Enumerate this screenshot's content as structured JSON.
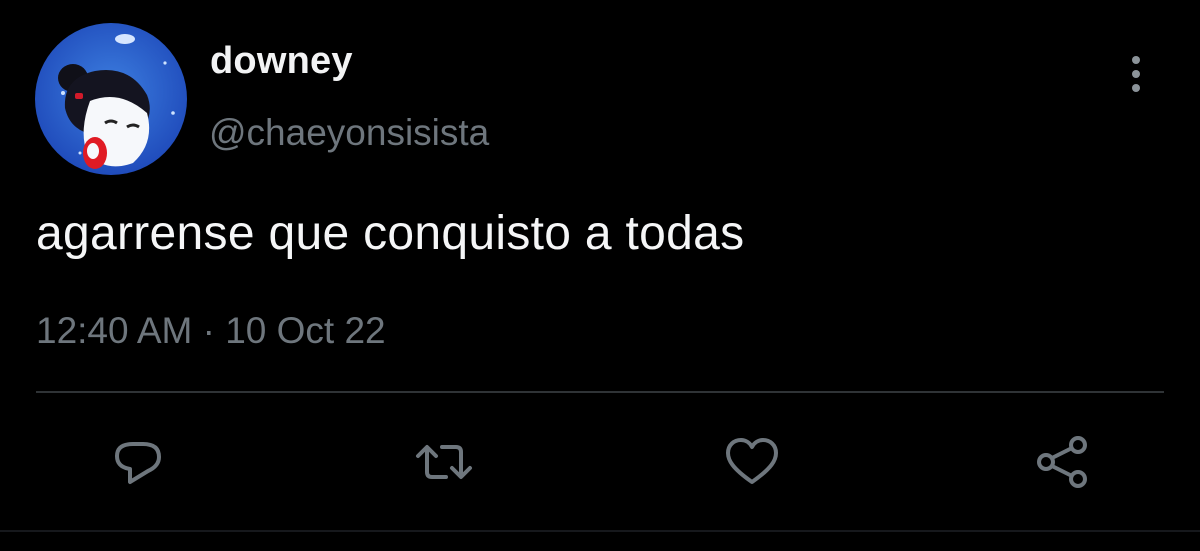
{
  "user": {
    "display_name": "downey",
    "handle": "@chaeyonsisista",
    "avatar_icon": "cartoon-avatar-icon"
  },
  "tweet": {
    "text": "agarrense que conquisto a todas",
    "timestamp": "12:40 AM · 10 Oct 22"
  },
  "actions": {
    "more": "more-options-icon",
    "reply": "reply-icon",
    "retweet": "retweet-icon",
    "like": "heart-icon",
    "share": "share-icon"
  },
  "colors": {
    "background": "#000000",
    "text_primary": "#f5f6f7",
    "text_secondary": "#6e767d",
    "divider": "#2f3336",
    "icon": "#6e767d"
  }
}
